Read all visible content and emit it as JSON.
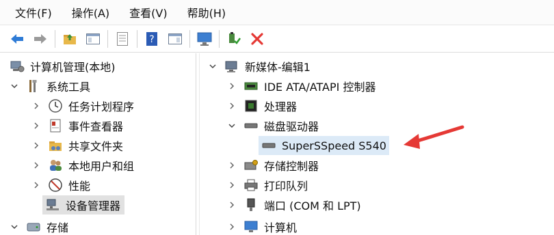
{
  "menu": [
    "文件(F)",
    "操作(A)",
    "查看(V)",
    "帮助(H)"
  ],
  "toolbar": {
    "icons": [
      "back-icon",
      "forward-icon",
      "up-folder-icon",
      "show-hide-tree-icon",
      "properties-icon",
      "help-icon",
      "action-pane-icon",
      "monitor-icon",
      "enable-device-icon",
      "uninstall-icon"
    ]
  },
  "left_tree": {
    "root": "计算机管理(本地)",
    "system_tools": "系统工具",
    "items": [
      "任务计划程序",
      "事件查看器",
      "共享文件夹",
      "本地用户和组",
      "性能",
      "设备管理器"
    ],
    "storage": "存储"
  },
  "right_tree": {
    "root": "新媒体-编辑1",
    "items": [
      "IDE ATA/ATAPI 控制器",
      "处理器",
      "磁盘驱动器",
      "SuperSSpeed S540",
      "存储控制器",
      "打印队列",
      "端口 (COM 和 LPT)",
      "计算机"
    ]
  },
  "colors": {
    "accent_red": "#e53935",
    "selection": "#dceaf7",
    "blue_icon": "#2e7bd6"
  }
}
